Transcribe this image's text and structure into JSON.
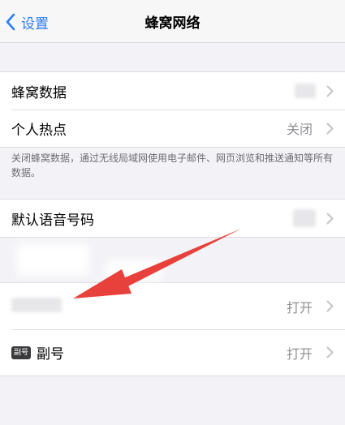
{
  "nav": {
    "back_label": "设置",
    "title": "蜂窝网络"
  },
  "group1": {
    "cellular_data_label": "蜂窝数据",
    "hotspot_label": "个人热点",
    "hotspot_value": "关闭"
  },
  "note": "关闭蜂窝数据，通过无线局域网使用电子邮件、网页浏览和推送通知等所有数据。",
  "group2": {
    "default_voice_label": "默认语音号码"
  },
  "group3": {
    "primary_value": "打开",
    "secondary_badge": "副号",
    "secondary_label": "副号",
    "secondary_value": "打开"
  },
  "colors": {
    "accent": "#2d7cf6",
    "annotation_arrow": "#e8403a"
  },
  "icons": {
    "back": "chevron-left-icon",
    "disclosure": "chevron-right-icon"
  }
}
